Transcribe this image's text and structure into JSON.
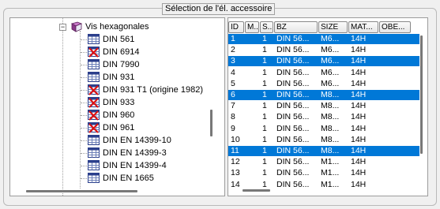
{
  "group": {
    "title": "Sélection de l'él. accessoire"
  },
  "tree": {
    "root": {
      "label": "Vis hexagonales",
      "expander": "−",
      "icon": "book-icon"
    },
    "items": [
      {
        "label": "DIN 561",
        "icon": "table-icon",
        "crossed": false
      },
      {
        "label": "DIN 6914",
        "icon": "table-crossed-icon",
        "crossed": true
      },
      {
        "label": "DIN 7990",
        "icon": "table-icon",
        "crossed": false
      },
      {
        "label": "DIN 931",
        "icon": "table-icon",
        "crossed": false
      },
      {
        "label": "DIN 931 T1 (origine 1982)",
        "icon": "table-crossed-icon",
        "crossed": true
      },
      {
        "label": "DIN 933",
        "icon": "table-crossed-icon",
        "crossed": true
      },
      {
        "label": "DIN 960",
        "icon": "table-crossed-icon",
        "crossed": true
      },
      {
        "label": "DIN 961",
        "icon": "table-crossed-icon",
        "crossed": true
      },
      {
        "label": "DIN EN 14399-10",
        "icon": "table-icon",
        "crossed": false
      },
      {
        "label": "DIN EN 14399-3",
        "icon": "table-icon",
        "crossed": false
      },
      {
        "label": "DIN EN 14399-4",
        "icon": "table-icon",
        "crossed": false
      },
      {
        "label": "DIN EN 1665",
        "icon": "table-icon",
        "crossed": false
      }
    ]
  },
  "grid": {
    "columns": [
      "ID",
      "M...",
      "S...",
      "BZ",
      "SIZE",
      "MAT...",
      "OBE..."
    ],
    "rows": [
      {
        "selected": true,
        "cells": [
          "1",
          "",
          "1",
          "DIN 56...",
          "M6...",
          "14H",
          ""
        ]
      },
      {
        "selected": false,
        "cells": [
          "2",
          "",
          "1",
          "DIN 56...",
          "M6...",
          "14H",
          ""
        ]
      },
      {
        "selected": true,
        "cells": [
          "3",
          "",
          "1",
          "DIN 56...",
          "M6...",
          "14H",
          ""
        ]
      },
      {
        "selected": false,
        "cells": [
          "4",
          "",
          "1",
          "DIN 56...",
          "M6...",
          "14H",
          ""
        ]
      },
      {
        "selected": false,
        "cells": [
          "5",
          "",
          "1",
          "DIN 56...",
          "M6...",
          "14H",
          ""
        ]
      },
      {
        "selected": true,
        "cells": [
          "6",
          "",
          "1",
          "DIN 56...",
          "M8...",
          "14H",
          ""
        ]
      },
      {
        "selected": false,
        "cells": [
          "7",
          "",
          "1",
          "DIN 56...",
          "M8...",
          "14H",
          ""
        ]
      },
      {
        "selected": false,
        "cells": [
          "8",
          "",
          "1",
          "DIN 56...",
          "M8...",
          "14H",
          ""
        ]
      },
      {
        "selected": false,
        "cells": [
          "9",
          "",
          "1",
          "DIN 56...",
          "M8...",
          "14H",
          ""
        ]
      },
      {
        "selected": false,
        "cells": [
          "10",
          "",
          "1",
          "DIN 56...",
          "M8...",
          "14H",
          ""
        ]
      },
      {
        "selected": true,
        "cells": [
          "11",
          "",
          "1",
          "DIN 56...",
          "M8...",
          "14H",
          ""
        ]
      },
      {
        "selected": false,
        "cells": [
          "12",
          "",
          "1",
          "DIN 56...",
          "M1...",
          "14H",
          ""
        ]
      },
      {
        "selected": false,
        "cells": [
          "13",
          "",
          "1",
          "DIN 56...",
          "M1...",
          "14H",
          ""
        ]
      },
      {
        "selected": false,
        "cells": [
          "14",
          "",
          "1",
          "DIN 56...",
          "M1...",
          "14H",
          ""
        ]
      }
    ]
  },
  "colors": {
    "selection": "#0078d7",
    "book": "#8b3a8b"
  }
}
